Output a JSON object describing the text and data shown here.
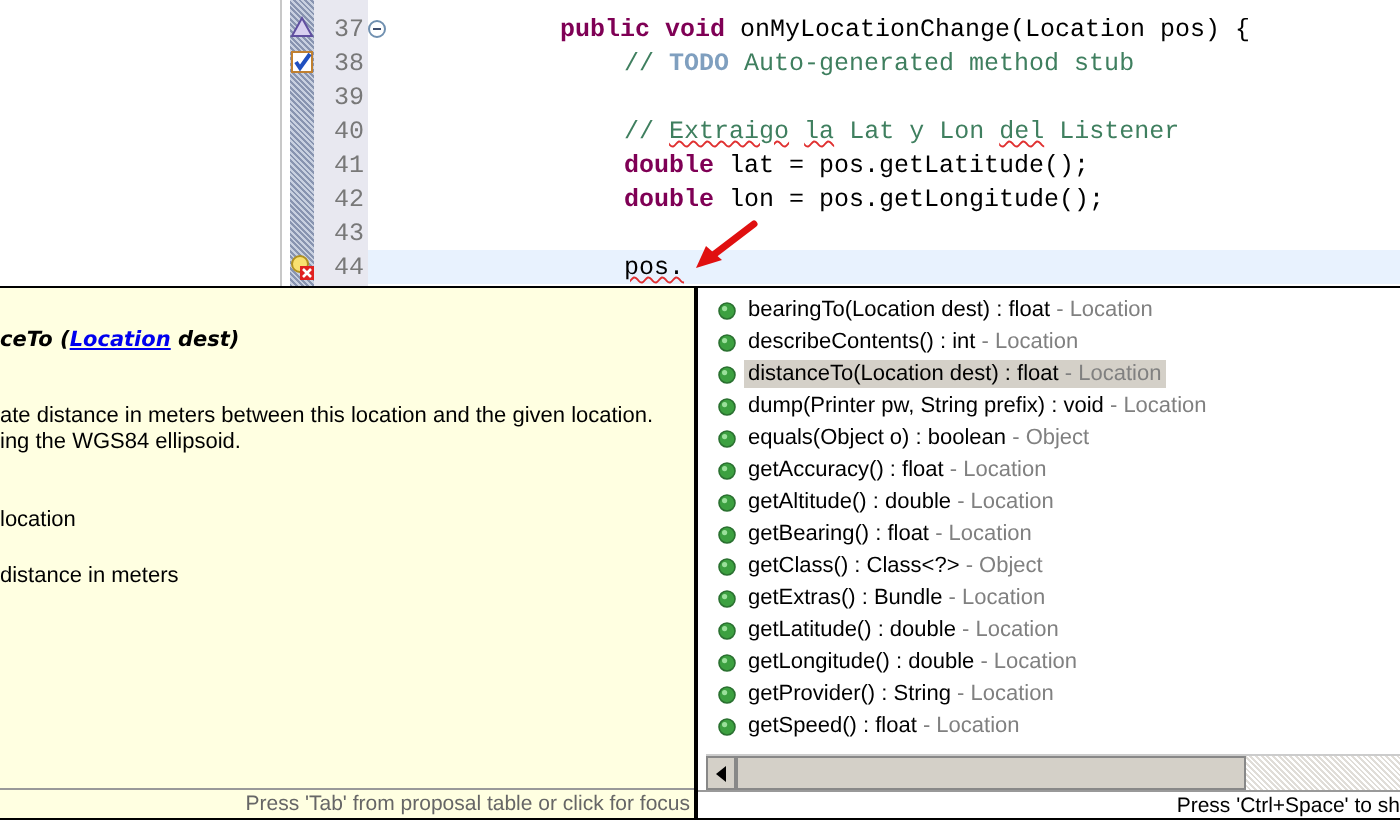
{
  "editor": {
    "lines": [
      {
        "number": "37",
        "kind": "override",
        "expanded": true,
        "current": false,
        "segments": [
          {
            "kind": "keyword",
            "text": "public void"
          },
          {
            "kind": "plain",
            "text": " onMyLocationChange(Location pos) {"
          }
        ],
        "children": [
          {
            "number": "38",
            "kind": "task",
            "current": false,
            "segments": [
              {
                "kind": "comment",
                "text": "// "
              },
              {
                "kind": "todo",
                "text": "TODO"
              },
              {
                "kind": "comment",
                "text": " Auto-generated method stub"
              }
            ]
          },
          {
            "number": "39",
            "kind": "plain",
            "current": false
          },
          {
            "number": "40",
            "kind": "plain",
            "current": false,
            "segments": [
              {
                "kind": "comment",
                "text": "// "
              },
              {
                "kind": "comment",
                "text": "Extraigo",
                "underlined": true
              },
              {
                "kind": "comment",
                "text": " la",
                "underlined": true
              },
              {
                "kind": "comment",
                "text": " Lat y Lon "
              },
              {
                "kind": "comment",
                "text": "del",
                "underlined": true
              },
              {
                "kind": "comment",
                "text": " Listener"
              }
            ]
          },
          {
            "number": "41",
            "kind": "plain",
            "current": false,
            "segments": [
              {
                "kind": "keyword",
                "text": "double"
              },
              {
                "kind": "plain",
                "text": " lat = pos.getLatitude();"
              }
            ]
          },
          {
            "number": "42",
            "kind": "plain",
            "current": false,
            "segments": [
              {
                "kind": "keyword",
                "text": "double"
              },
              {
                "kind": "plain",
                "text": " lon = pos.getLongitude();"
              }
            ]
          },
          {
            "number": "43",
            "kind": "plain",
            "current": false
          },
          {
            "number": "44",
            "kind": "error",
            "current": true,
            "segments": [
              {
                "kind": "plain",
                "text": "pos.",
                "underlined": true
              }
            ]
          }
        ]
      }
    ]
  },
  "javadoc": {
    "heading": {
      "before": "ceTo (",
      "link": "Location",
      "after": " dest)"
    },
    "description": [
      "ate distance in meters between this location and the given location.",
      "ing the WGS84 ellipsoid."
    ],
    "params": [
      "location"
    ],
    "returns": [
      "distance in meters"
    ],
    "status": "Press 'Tab' from proposal table or click for focus"
  },
  "proposals": {
    "items": [
      {
        "signature": "bearingTo(Location dest) : float",
        "owner": "- Location",
        "selected": false
      },
      {
        "signature": "describeContents() : int",
        "owner": "- Location",
        "selected": false
      },
      {
        "signature": "distanceTo(Location dest) : float",
        "owner": "- Location",
        "selected": true
      },
      {
        "signature": "dump(Printer pw, String prefix) : void",
        "owner": "- Location",
        "selected": false
      },
      {
        "signature": "equals(Object o) : boolean",
        "owner": "- Object",
        "selected": false
      },
      {
        "signature": "getAccuracy() : float",
        "owner": "- Location",
        "selected": false
      },
      {
        "signature": "getAltitude() : double",
        "owner": "- Location",
        "selected": false
      },
      {
        "signature": "getBearing() : float",
        "owner": "- Location",
        "selected": false
      },
      {
        "signature": "getClass() : Class<?>",
        "owner": "- Object",
        "selected": false
      },
      {
        "signature": "getExtras() : Bundle",
        "owner": "- Location",
        "selected": false
      },
      {
        "signature": "getLatitude() : double",
        "owner": "- Location",
        "selected": false
      },
      {
        "signature": "getLongitude() : double",
        "owner": "- Location",
        "selected": false
      },
      {
        "signature": "getProvider() : String",
        "owner": "- Location",
        "selected": false
      },
      {
        "signature": "getSpeed() : float",
        "owner": "- Location",
        "selected": false
      }
    ],
    "status": "Press 'Ctrl+Space' to sh"
  }
}
